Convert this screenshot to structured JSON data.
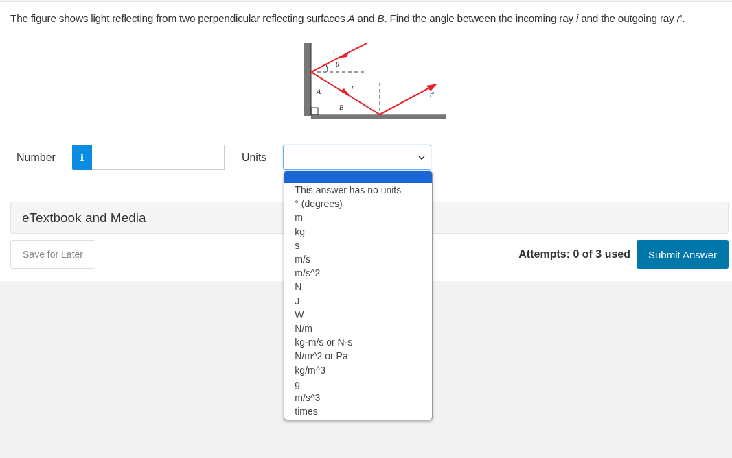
{
  "question": "The figure shows light reflecting from two perpendicular reflecting surfaces *A* and *B*. Find the angle between the incoming ray *i* and the outgoing ray *r*'.",
  "figure": {
    "labels": [
      "i",
      "θ",
      "r",
      "A",
      "r'",
      "B"
    ]
  },
  "answer": {
    "number_label": "Number",
    "info_icon": "i",
    "units_label": "Units"
  },
  "units_dropdown": {
    "expanded": true,
    "blank_option_highlighted": true,
    "options": [
      "This answer has no units",
      "° (degrees)",
      "m",
      "kg",
      "s",
      "m/s",
      "m/s^2",
      "N",
      "J",
      "W",
      "N/m",
      "kg·m/s or N·s",
      "N/m^2 or Pa",
      "kg/m^3",
      "g",
      "m/s^3",
      "times"
    ]
  },
  "media_panel": {
    "title": "eTextbook and Media"
  },
  "footer": {
    "save_button": "Save for Later",
    "attempts": "Attempts: 0 of 3 used",
    "submit_button": "Submit Answer"
  }
}
